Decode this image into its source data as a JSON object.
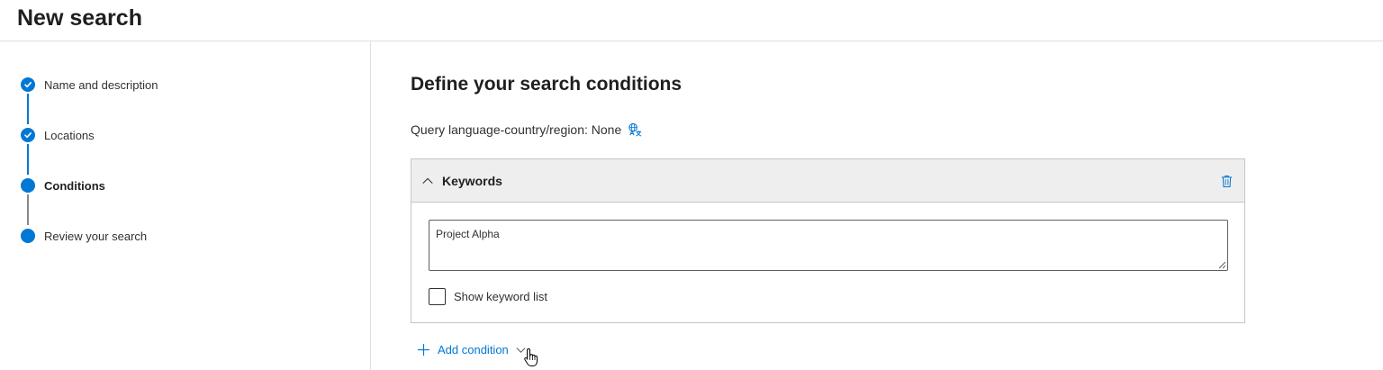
{
  "header": {
    "title": "New search"
  },
  "wizard": {
    "steps": [
      {
        "label": "Name and description",
        "state": "done"
      },
      {
        "label": "Locations",
        "state": "done"
      },
      {
        "label": "Conditions",
        "state": "current"
      },
      {
        "label": "Review your search",
        "state": "pending"
      }
    ]
  },
  "main": {
    "title": "Define your search conditions",
    "query_language": "Query language-country/region: None",
    "keywords_card": {
      "title": "Keywords",
      "value": "Project Alpha",
      "show_keyword_list_label": "Show keyword list",
      "show_keyword_list_checked": false
    },
    "add_condition_label": "Add condition"
  },
  "colors": {
    "accent": "#0078d4",
    "text": "#323130",
    "border": "#c8c6c4",
    "card_header_bg": "#eeeeee"
  },
  "icons": {
    "step_done": "checkmark-icon",
    "language": "translate-globe-icon",
    "collapse": "chevron-up-icon",
    "delete": "trash-icon",
    "add": "plus-icon",
    "dropdown": "chevron-down-icon",
    "pointer": "hand-pointer-icon"
  }
}
